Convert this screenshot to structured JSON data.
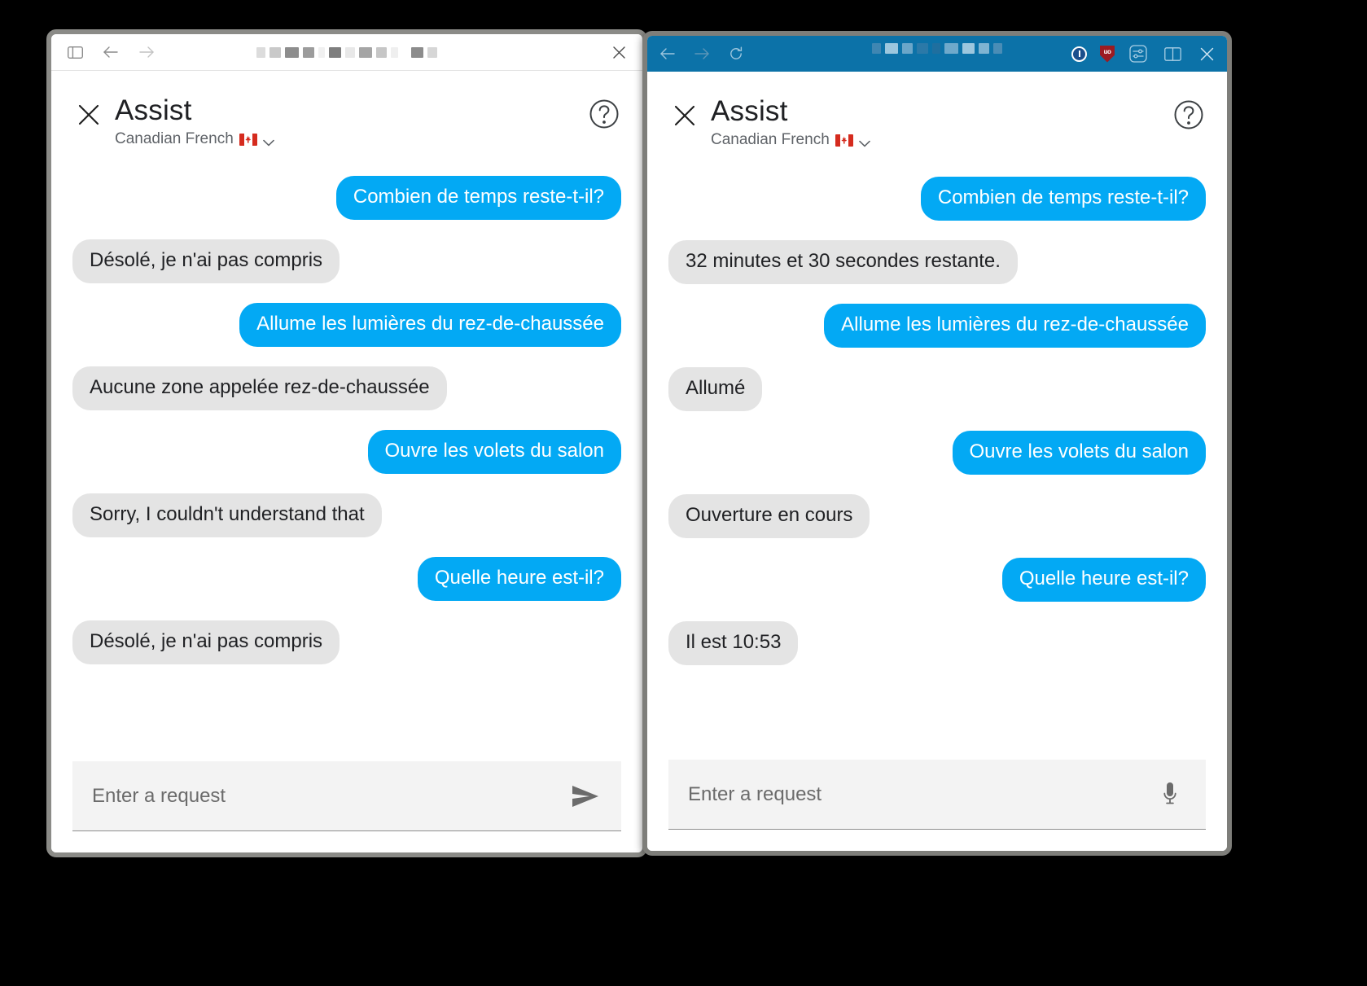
{
  "theme": {
    "user_bubble_color": "#03a9f4",
    "bot_bubble_color": "#e4e4e4",
    "right_chrome_color": "#0c72a8",
    "page_background": "#000000"
  },
  "left_window": {
    "chrome": {
      "sidebar_toggle_icon": "sidebar-toggle-icon",
      "back_icon": "back-arrow-icon",
      "forward_icon": "forward-arrow-icon",
      "close_icon": "close-icon",
      "title_redacted": ""
    },
    "assist": {
      "close_label": "close-icon",
      "title": "Assist",
      "language": "Canadian French",
      "language_flag": "canada-flag-icon",
      "language_chevron": "chevron-down-icon",
      "help_icon": "help-circle-icon",
      "messages": [
        {
          "role": "user",
          "text": "Combien de temps reste-t-il?"
        },
        {
          "role": "bot",
          "text": "Désolé, je n'ai pas compris"
        },
        {
          "role": "user",
          "text": "Allume les lumières du rez-de-chaussée"
        },
        {
          "role": "bot",
          "text": "Aucune zone appelée rez-de-chaussée"
        },
        {
          "role": "user",
          "text": "Ouvre les volets du salon"
        },
        {
          "role": "bot",
          "text": "Sorry, I couldn't understand that"
        },
        {
          "role": "user",
          "text": "Quelle heure est-il?"
        },
        {
          "role": "bot",
          "text": "Désolé, je n'ai pas compris"
        }
      ],
      "input": {
        "value": "",
        "placeholder": "Enter a request",
        "action_icon": "send-icon"
      }
    }
  },
  "right_window": {
    "chrome": {
      "back_icon": "back-arrow-icon",
      "forward_icon": "forward-arrow-icon",
      "reload_icon": "reload-icon",
      "title_redacted": "",
      "password_manager_icon": "1password-icon",
      "adblock_icon": "ublock-origin-icon",
      "extension_icon": "extension-settings-icon",
      "split_view_icon": "split-view-icon",
      "close_icon": "close-icon"
    },
    "assist": {
      "close_label": "close-icon",
      "title": "Assist",
      "language": "Canadian French",
      "language_flag": "canada-flag-icon",
      "language_chevron": "chevron-down-icon",
      "help_icon": "help-circle-icon",
      "messages": [
        {
          "role": "user",
          "text": "Combien de temps reste-t-il?"
        },
        {
          "role": "bot",
          "text": "32 minutes et 30 secondes restante."
        },
        {
          "role": "user",
          "text": "Allume les lumières du rez-de-chaussée"
        },
        {
          "role": "bot",
          "text": "Allumé"
        },
        {
          "role": "user",
          "text": "Ouvre les volets du salon"
        },
        {
          "role": "bot",
          "text": "Ouverture en cours"
        },
        {
          "role": "user",
          "text": "Quelle heure est-il?"
        },
        {
          "role": "bot",
          "text": "Il est 10:53"
        }
      ],
      "input": {
        "value": "",
        "placeholder": "Enter a request",
        "action_icon": "microphone-icon"
      }
    }
  }
}
